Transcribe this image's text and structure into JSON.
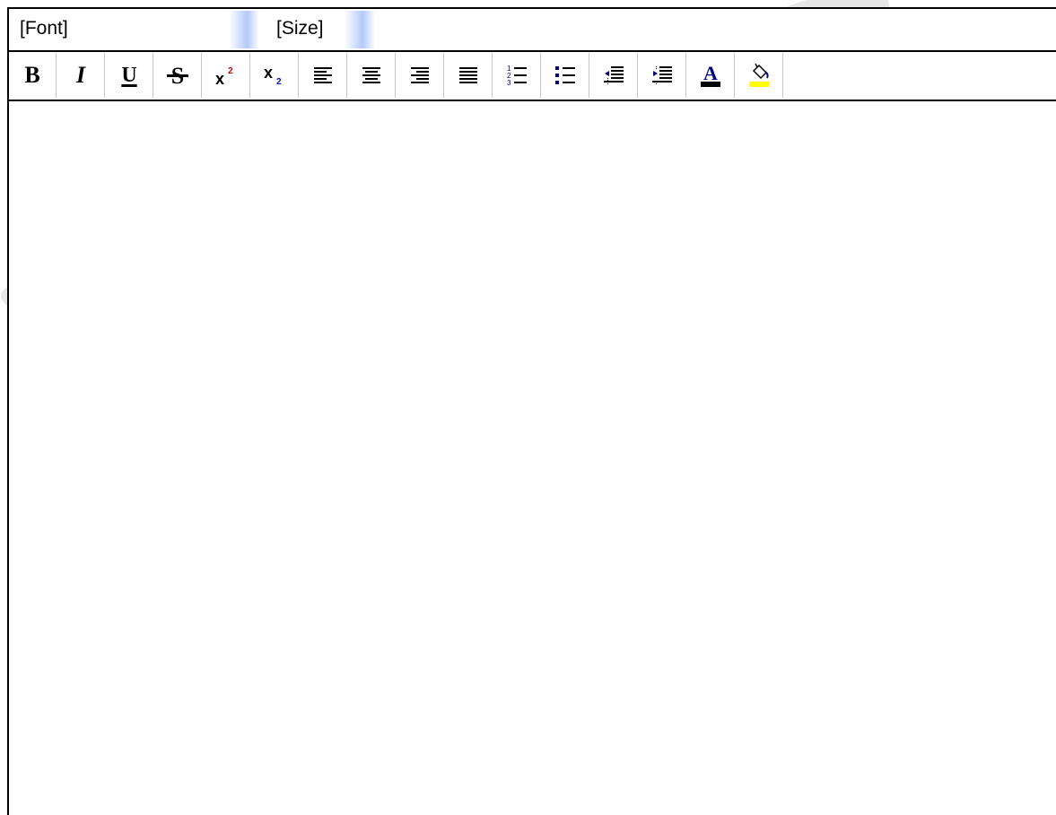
{
  "font_row": {
    "font_label": "[Font]",
    "size_label": "[Size]"
  },
  "toolbar": {
    "buttons": [
      {
        "name": "bold-button",
        "icon": "bold-icon",
        "glyph": "B"
      },
      {
        "name": "italic-button",
        "icon": "italic-icon",
        "glyph": "I"
      },
      {
        "name": "underline-button",
        "icon": "underline-icon",
        "glyph": "U"
      },
      {
        "name": "strikethrough-button",
        "icon": "strikethrough-icon"
      },
      {
        "name": "superscript-button",
        "icon": "superscript-icon"
      },
      {
        "name": "subscript-button",
        "icon": "subscript-icon"
      },
      {
        "name": "align-left-button",
        "icon": "align-left-icon"
      },
      {
        "name": "align-center-button",
        "icon": "align-center-icon"
      },
      {
        "name": "align-right-button",
        "icon": "align-right-icon"
      },
      {
        "name": "justify-button",
        "icon": "justify-icon"
      },
      {
        "name": "numbered-list-button",
        "icon": "numbered-list-icon"
      },
      {
        "name": "bulleted-list-button",
        "icon": "bulleted-list-icon"
      },
      {
        "name": "outdent-button",
        "icon": "outdent-icon"
      },
      {
        "name": "indent-button",
        "icon": "indent-icon"
      },
      {
        "name": "font-color-button",
        "icon": "font-color-icon"
      },
      {
        "name": "highlight-color-button",
        "icon": "paint-bucket-icon"
      }
    ]
  },
  "colors": {
    "accent_blue": "#b4c9f9",
    "font_color_bar": "#000000",
    "highlight_bar": "#ffff00",
    "icon_navy": "#000080",
    "watermark_gray": "#e6e6e6"
  },
  "watermark": {
    "text": "vzor"
  }
}
